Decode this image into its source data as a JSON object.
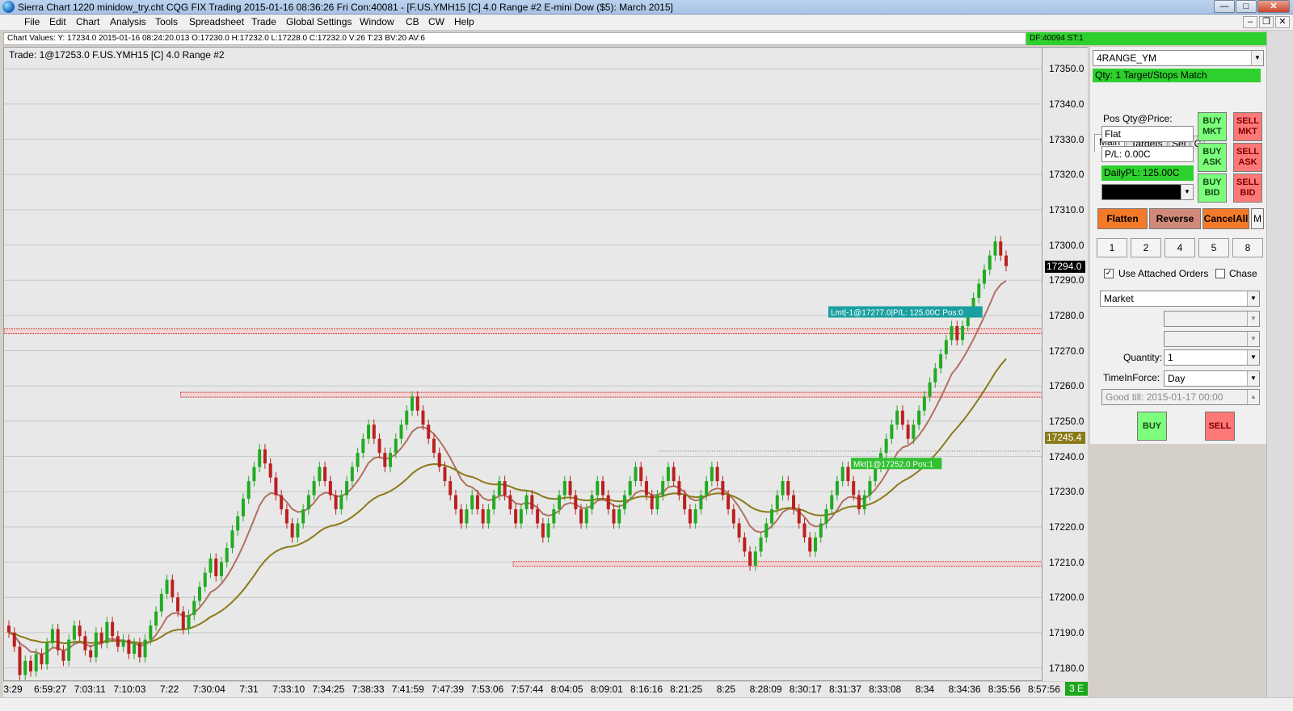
{
  "window": {
    "title": "Sierra Chart 1220 minidow_try.cht  CQG FIX Trading 2015-01-16  08:36:26 Fri   Con:40081 - [F.US.YMH15 [C]  4.0 Range  #2  E-mini Dow ($5): March 2015]",
    "buttons": {
      "minimize": "—",
      "maximize": "□",
      "close": "✕"
    }
  },
  "menu": {
    "items": [
      "File",
      "Edit",
      "Chart",
      "Analysis",
      "Tools",
      "Spreadsheet",
      "Trade",
      "Global Settings",
      "Window",
      "CB",
      "CW",
      "Help"
    ],
    "mdi_buttons": {
      "minimize": "–",
      "restore": "❐",
      "close": "✕"
    }
  },
  "chart_values_bar": "Chart Values: Y: 17234.0  2015-01-16  08:24:20.013  O:17230.0  H:17232.0  L:17228.0  C:17232.0  V:26  T:23  BV:20  AV:6",
  "df_bar": "DF:40094  ST:1",
  "trade_label": "Trade:  1@17253.0 F.US.YMH15 [C]  4.0 Range  #2",
  "colors": {
    "chart_bg": "#e8e8e8",
    "up_bar": "#22aa22",
    "down_bar": "#bb2020",
    "ma_fast": "#b07060",
    "ma_slow": "#8a7a18",
    "limit_order": "#1aa0a0",
    "market_order": "#30c030",
    "price_tag": "#000000"
  },
  "chart_data": {
    "type": "candlestick",
    "symbol": "F.US.YMH15",
    "bar_type": "4.0 Range",
    "ylim": [
      17176,
      17356
    ],
    "yticks": [
      17350,
      17340,
      17330,
      17320,
      17310,
      17300,
      17290,
      17280,
      17270,
      17260,
      17250,
      17240,
      17230,
      17220,
      17210,
      17200,
      17190,
      17180
    ],
    "xticks": [
      "3:29",
      "6:59:27",
      "7:03:11",
      "7:10:03",
      "7:22",
      "7:30:04",
      "7:31",
      "7:33:10",
      "7:34:25",
      "7:38:33",
      "7:41:59",
      "7:47:39",
      "7:53:06",
      "7:57:44",
      "8:04:05",
      "8:09:01",
      "8:16:16",
      "8:21:25",
      "8:25",
      "8:28:09",
      "8:30:17",
      "8:31:37",
      "8:33:08",
      "8:34",
      "8:34:36",
      "8:35:56",
      "8:57:56"
    ],
    "closes": [
      17190,
      17186,
      17178,
      17182,
      17179,
      17184,
      17181,
      17187,
      17191,
      17185,
      17182,
      17188,
      17192,
      17189,
      17185,
      17183,
      17190,
      17187,
      17193,
      17189,
      17186,
      17188,
      17184,
      17187,
      17183,
      17188,
      17192,
      17196,
      17201,
      17205,
      17200,
      17196,
      17191,
      17195,
      17199,
      17203,
      17207,
      17211,
      17206,
      17210,
      17214,
      17219,
      17223,
      17228,
      17233,
      17237,
      17242,
      17238,
      17234,
      17229,
      17225,
      17221,
      17217,
      17221,
      17225,
      17229,
      17233,
      17237,
      17233,
      17229,
      17225,
      17229,
      17233,
      17237,
      17241,
      17245,
      17249,
      17245,
      17241,
      17237,
      17241,
      17245,
      17249,
      17253,
      17257,
      17253,
      17249,
      17245,
      17241,
      17237,
      17233,
      17229,
      17225,
      17221,
      17225,
      17229,
      17225,
      17221,
      17225,
      17229,
      17233,
      17229,
      17225,
      17221,
      17225,
      17229,
      17225,
      17221,
      17217,
      17221,
      17225,
      17229,
      17233,
      17229,
      17225,
      17221,
      17225,
      17229,
      17233,
      17229,
      17225,
      17221,
      17225,
      17229,
      17233,
      17237,
      17233,
      17229,
      17225,
      17229,
      17233,
      17237,
      17233,
      17229,
      17225,
      17221,
      17225,
      17229,
      17233,
      17237,
      17233,
      17229,
      17225,
      17221,
      17217,
      17213,
      17209,
      17213,
      17217,
      17221,
      17225,
      17229,
      17233,
      17229,
      17225,
      17221,
      17217,
      17213,
      17217,
      17221,
      17225,
      17229,
      17233,
      17237,
      17233,
      17229,
      17225,
      17229,
      17233,
      17237,
      17241,
      17245,
      17249,
      17253,
      17249,
      17245,
      17249,
      17253,
      17257,
      17261,
      17265,
      17269,
      17273,
      17277,
      17273,
      17277,
      17281,
      17285,
      17289,
      17293,
      17297,
      17301,
      17297,
      17294
    ],
    "studies": [
      {
        "name": "MA fast",
        "color": "#b07060"
      },
      {
        "name": "MA slow",
        "color": "#8a7a18"
      }
    ],
    "levels": [
      {
        "price": 17275.5,
        "from": 0.0,
        "style": "red-zone"
      },
      {
        "price": 17257.5,
        "from": 0.17,
        "style": "red-zone"
      },
      {
        "price": 17209.5,
        "from": 0.49,
        "style": "red-zone"
      },
      {
        "price": 17241.5,
        "from": 0.63,
        "style": "dotted"
      }
    ],
    "price_tags": [
      {
        "label": "17294.0",
        "price": 17294.0,
        "bg": "#000000",
        "fg": "#ffffff"
      },
      {
        "label": "17245.4",
        "price": 17245.4,
        "bg": "#8a7a18",
        "fg": "#ffffff"
      }
    ],
    "order_labels": [
      {
        "text": "Lmt|-1@17277.0|P/L: 125.00C Pos:0",
        "price": 17281,
        "bg": "#1aa0a0"
      },
      {
        "text": "Mkt|1@17252.0 Pos:1",
        "price": 17238,
        "bg": "#30c030"
      }
    ]
  },
  "x_corner": "3 E",
  "panel": {
    "symbol_select": "4RANGE_YM",
    "qty_bar": "Qty: 1 Target/Stops Match",
    "tabs": [
      "Main",
      "Targets",
      "Set",
      "C"
    ],
    "pos_label": "Pos Qty@Price:",
    "pos_value": "Flat",
    "pl_value": "P/L: 0.00C",
    "daily_pl": "DailyPL: 125.00C",
    "buy_buttons": [
      [
        "BUY",
        "MKT"
      ],
      [
        "BUY",
        "ASK"
      ],
      [
        "BUY",
        "BID"
      ]
    ],
    "sell_buttons": [
      [
        "SELL",
        "MKT"
      ],
      [
        "SELL",
        "ASK"
      ],
      [
        "SELL",
        "BID"
      ]
    ],
    "flatten": "Flatten",
    "reverse": "Reverse",
    "cancel_all": "CancelAll",
    "m_button": "M",
    "qty_presets": [
      "1",
      "2",
      "4",
      "5",
      "8"
    ],
    "use_attached_orders": "Use Attached Orders",
    "chase": "Chase",
    "order_type": "Market",
    "quantity_label": "Quantity:",
    "quantity_value": "1",
    "tif_label": "TimeInForce:",
    "tif_value": "Day",
    "good_till": "Good till: 2015-01-17 00:00",
    "buy": "BUY",
    "sell": "SELL"
  }
}
